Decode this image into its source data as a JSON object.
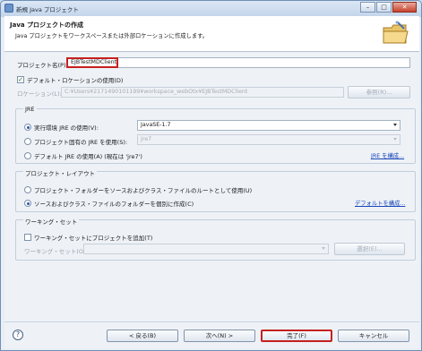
{
  "window": {
    "title": "新規 Java プロジェクト",
    "minimize": "–",
    "maximize": "□",
    "close": "✕"
  },
  "header": {
    "title": "Java プロジェクトの作成",
    "description": "Java プロジェクトをワークスペースまたは外部ロケーションに作成します。"
  },
  "project_name": {
    "label": "プロジェクト名(P):",
    "value": "EJBTestMDClient"
  },
  "default_location": {
    "checked": true,
    "label": "デフォルト・ロケーションの使用(D)",
    "location_label": "ロケーション(L):",
    "location_value": "C:¥Users¥2171490101199¥workspace_webOtx¥EJBTestMDClient",
    "browse_button": "参照(R)..."
  },
  "jre": {
    "group_title": "JRE",
    "option_env": "実行環境 JRE の使用(V):",
    "env_value": "JavaSE-1.7",
    "option_project": "プロジェクト固有の JRE を使用(S):",
    "project_value": "jre7",
    "option_default": "デフォルト JRE の使用(A) (現在は 'jre7')",
    "configure_link": "JRE を構成..."
  },
  "layout": {
    "group_title": "プロジェクト・レイアウト",
    "option_root": "プロジェクト・フォルダーをソースおよびクラス・ファイルのルートとして使用(U)",
    "option_separate": "ソースおよびクラス・ファイルのフォルダーを個別に作成(C)",
    "configure_link": "デフォルトを構成..."
  },
  "working_set": {
    "group_title": "ワーキング・セット",
    "add_label": "ワーキング・セットにプロジェクトを追加(T)",
    "sets_label": "ワーキング・セット(O):",
    "select_button": "選択(E)..."
  },
  "footer": {
    "help": "?",
    "back": "< 戻る(B)",
    "next": "次へ(N) >",
    "finish": "完了(F)",
    "cancel": "キャンセル"
  },
  "icons": [
    "app-icon",
    "folder-wizard-icon",
    "help-icon",
    "dropdown-arrow-icon"
  ],
  "colors": {
    "focus_border": "#c62020",
    "link": "#1a47b8",
    "titlebar": "#c3d5ea"
  }
}
